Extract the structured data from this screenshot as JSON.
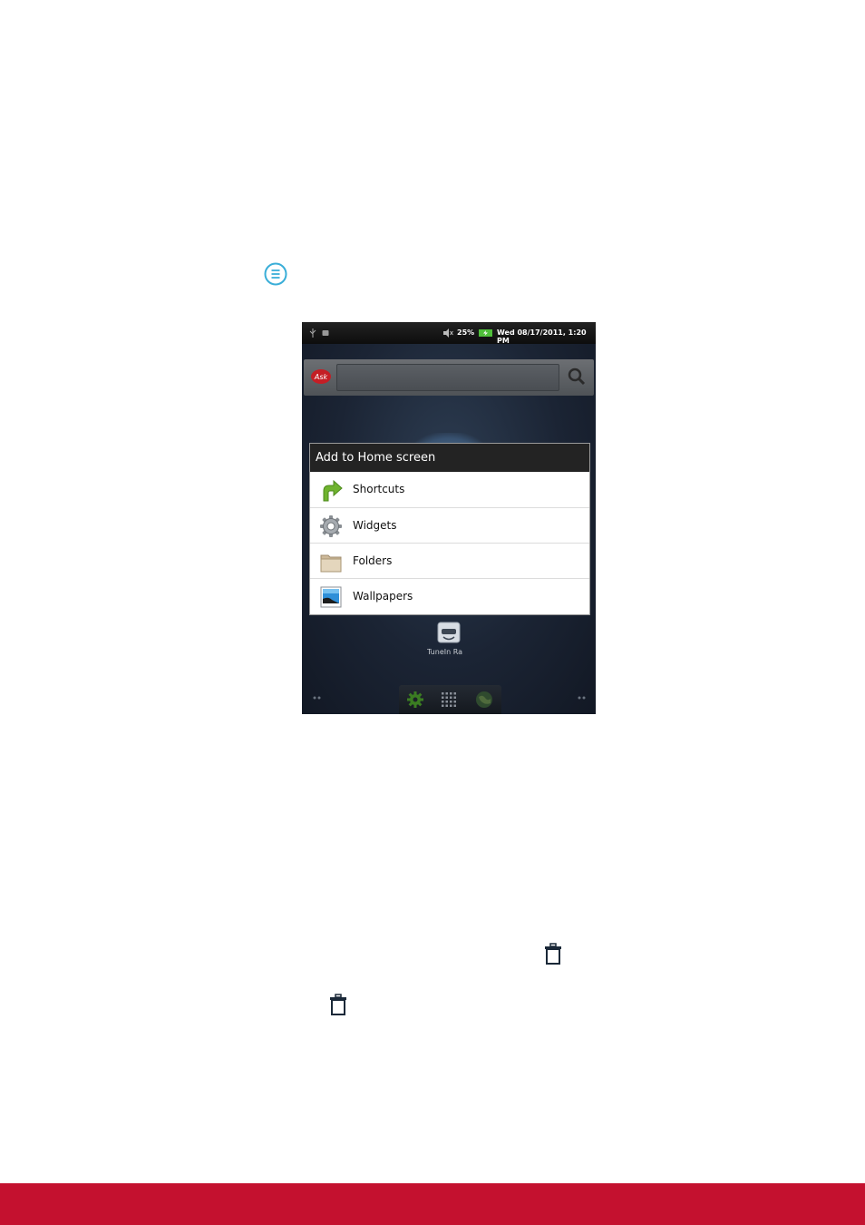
{
  "colors": {
    "accent_red": "#c4112f",
    "menu_icon_teal": "#3aaed8",
    "dialog_title_bg": "#232323",
    "shortcut_green": "#6fb32e"
  },
  "icons": {
    "menu": "menu-icon",
    "trash": "trash-icon"
  },
  "statusbar": {
    "battery": "25%",
    "datetime": "Wed 08/17/2011, 1:20 PM"
  },
  "search": {
    "logo_text": "Ask"
  },
  "dialog": {
    "title": "Add to Home screen",
    "items": [
      {
        "label": "Shortcuts",
        "icon": "shortcut-arrow-icon"
      },
      {
        "label": "Widgets",
        "icon": "gear-icon"
      },
      {
        "label": "Folders",
        "icon": "folder-icon"
      },
      {
        "label": "Wallpapers",
        "icon": "wallpaper-icon"
      }
    ]
  },
  "home": {
    "app_label": "TuneIn Ra"
  }
}
